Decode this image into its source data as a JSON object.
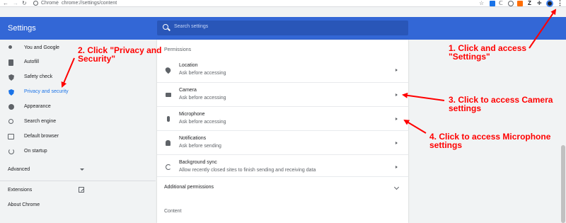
{
  "browser": {
    "site_label": "Chrome",
    "separator": "|",
    "url": "chrome://settings/content",
    "extension_letter": "Z",
    "icons": [
      "back-arrow-icon",
      "forward-arrow-icon",
      "reload-icon",
      "star-icon",
      "menu-dots-icon"
    ],
    "menu_glyph": "⋮"
  },
  "header": {
    "title": "Settings",
    "search_placeholder": "Search settings",
    "color": "#3367d6"
  },
  "sidebar": {
    "items": [
      {
        "label": "You and Google",
        "icon": "person-icon"
      },
      {
        "label": "Autofill",
        "icon": "clipboard-icon"
      },
      {
        "label": "Safety check",
        "icon": "shield-icon"
      },
      {
        "label": "Privacy and security",
        "icon": "shield-icon",
        "active": true
      },
      {
        "label": "Appearance",
        "icon": "palette-icon"
      },
      {
        "label": "Search engine",
        "icon": "search-icon"
      },
      {
        "label": "Default browser",
        "icon": "browser-icon"
      },
      {
        "label": "On startup",
        "icon": "power-icon"
      }
    ],
    "advanced": "Advanced",
    "extensions": "Extensions",
    "about": "About Chrome"
  },
  "main": {
    "permissions_title": "Permissions",
    "rows": [
      {
        "title": "Location",
        "subtitle": "Ask before accessing",
        "icon": "location-pin-icon"
      },
      {
        "title": "Camera",
        "subtitle": "Ask before accessing",
        "icon": "camera-icon"
      },
      {
        "title": "Microphone",
        "subtitle": "Ask before accessing",
        "icon": "microphone-icon"
      },
      {
        "title": "Notifications",
        "subtitle": "Ask before sending",
        "icon": "bell-icon"
      },
      {
        "title": "Background sync",
        "subtitle": "Allow recently closed sites to finish sending and receiving data",
        "icon": "sync-icon"
      }
    ],
    "additional_permissions": "Additional permissions",
    "content_title": "Content"
  },
  "annotations": {
    "step1_line1": "1. Click and access",
    "step1_line2": "\"Settings\"",
    "step2_line1": "2. Click \"Privacy and",
    "step2_line2": "Security\"",
    "step3_line1": "3. Click to access Camera",
    "step3_line2": "settings",
    "step4_line1": "4. Click to access Microphone",
    "step4_line2": "settings",
    "color": "#ff0000"
  }
}
